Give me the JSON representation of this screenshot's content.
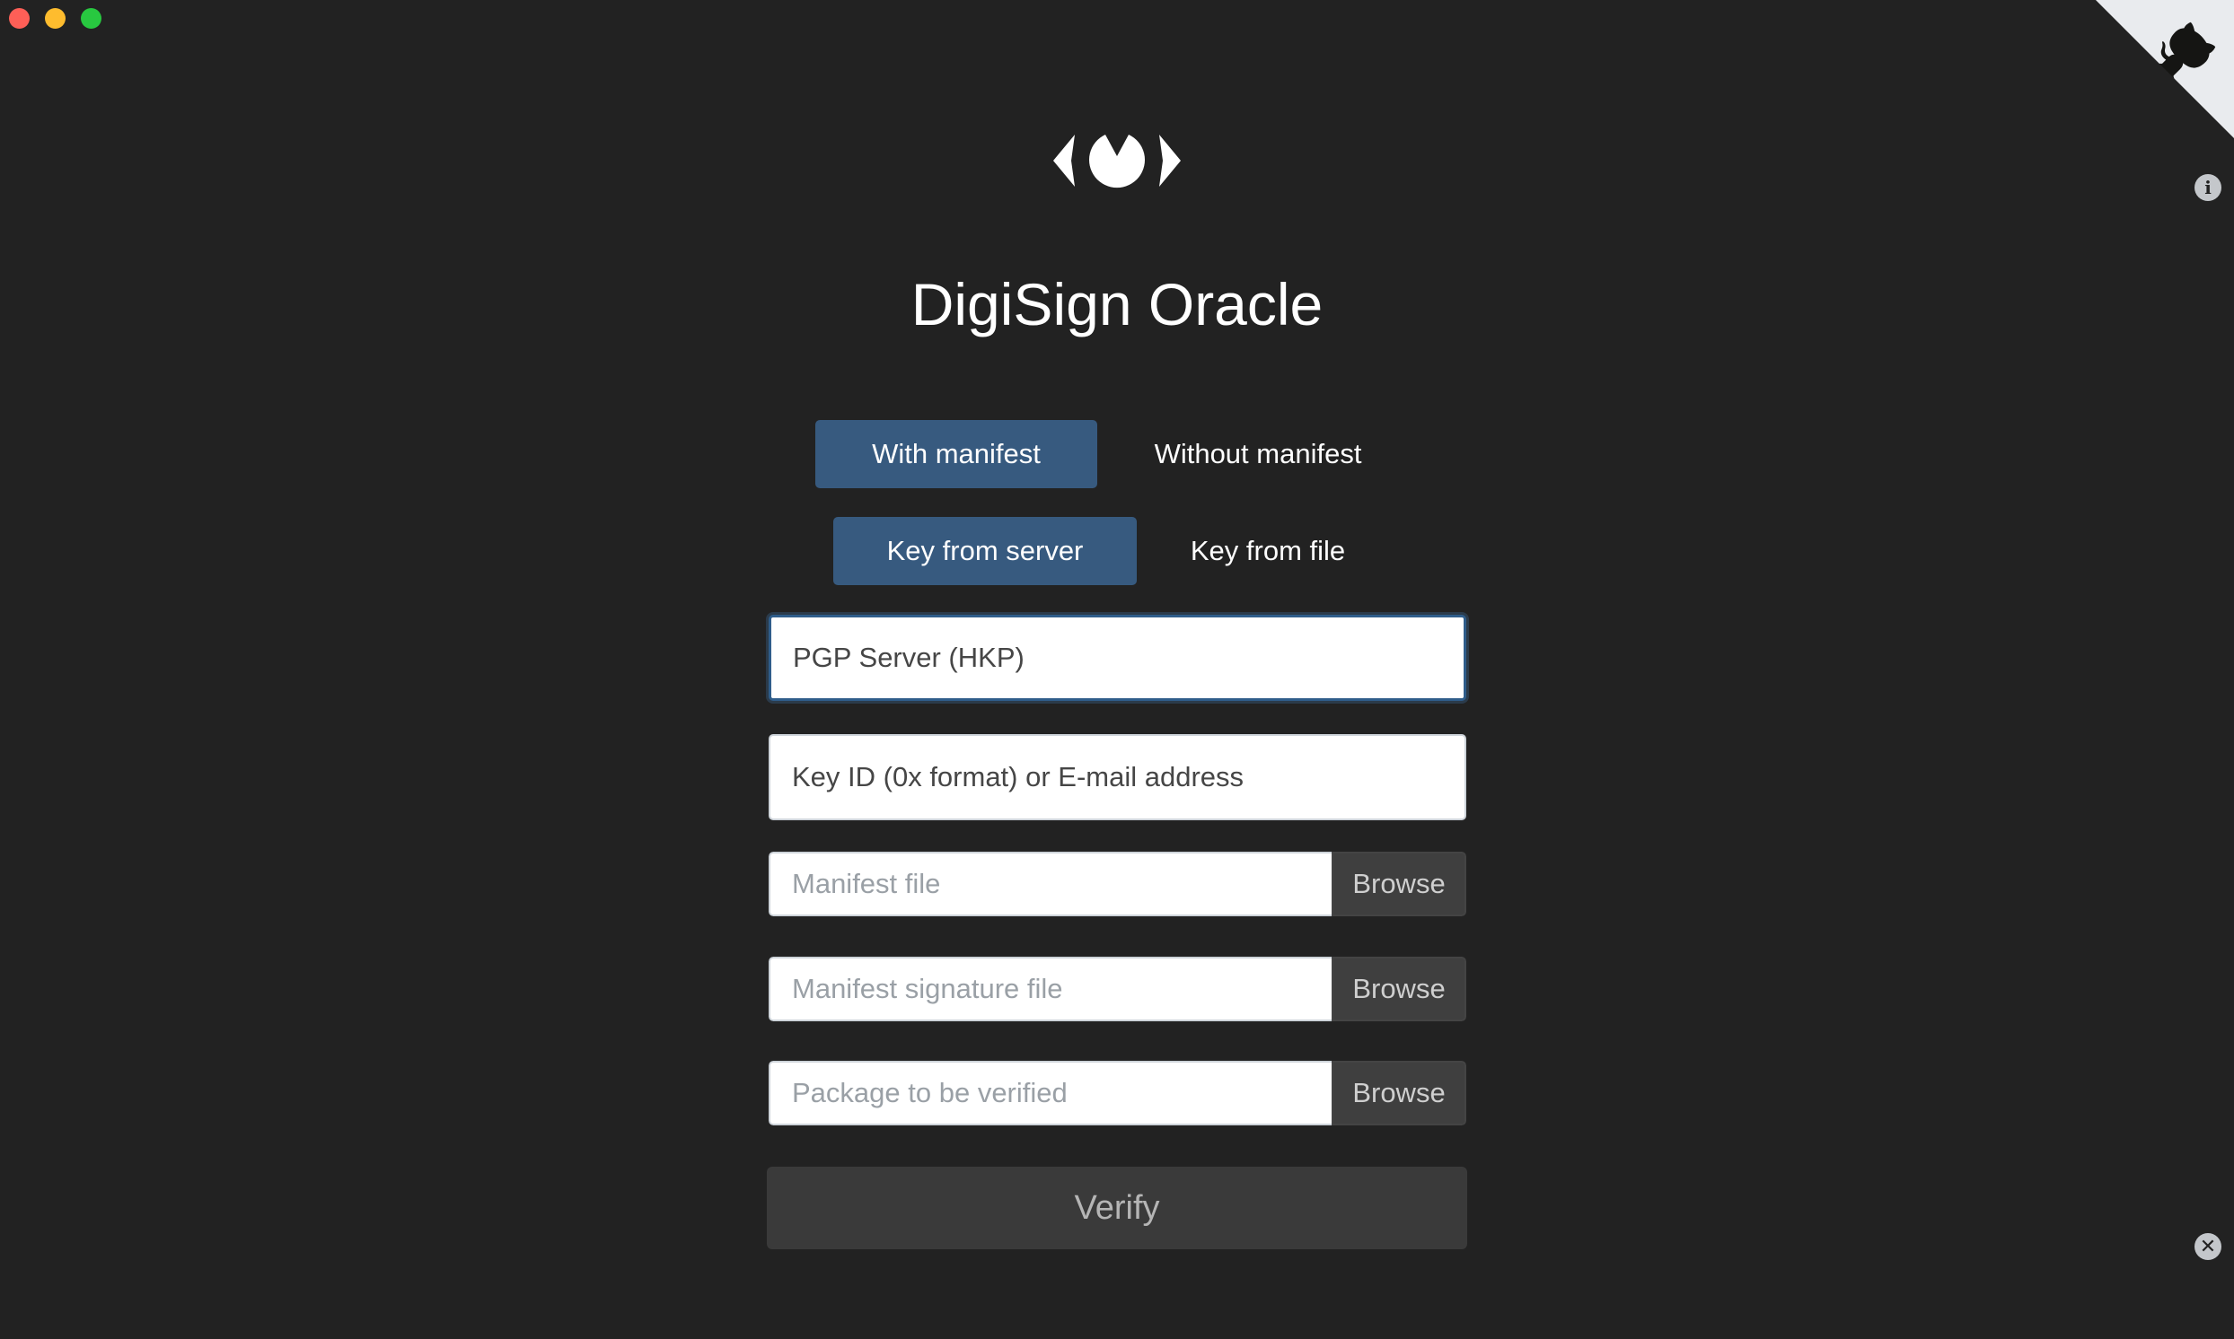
{
  "window": {
    "controls": [
      "close",
      "minimize",
      "maximize"
    ]
  },
  "icons": {
    "github": "github-octocat-icon",
    "info": "info-icon",
    "close": "close-icon",
    "logo": "eye-logo-icon"
  },
  "app": {
    "title": "DigiSign Oracle"
  },
  "mode_toggle": {
    "with_manifest": "With manifest",
    "without_manifest": "Without manifest",
    "active": "with_manifest"
  },
  "key_toggle": {
    "from_server": "Key from server",
    "from_file": "Key from file",
    "active": "from_server"
  },
  "form": {
    "server_placeholder": "PGP Server (HKP)",
    "key_placeholder": "Key ID (0x format) or E-mail address",
    "manifest_placeholder": "Manifest file",
    "signature_placeholder": "Manifest signature file",
    "package_placeholder": "Package to be verified",
    "browse_label": "Browse",
    "verify_label": "Verify"
  },
  "colors": {
    "background": "#222222",
    "active_toggle": "#375a7f",
    "browse_button": "#3f3f3f",
    "verify_button": "#3a3a3a"
  }
}
